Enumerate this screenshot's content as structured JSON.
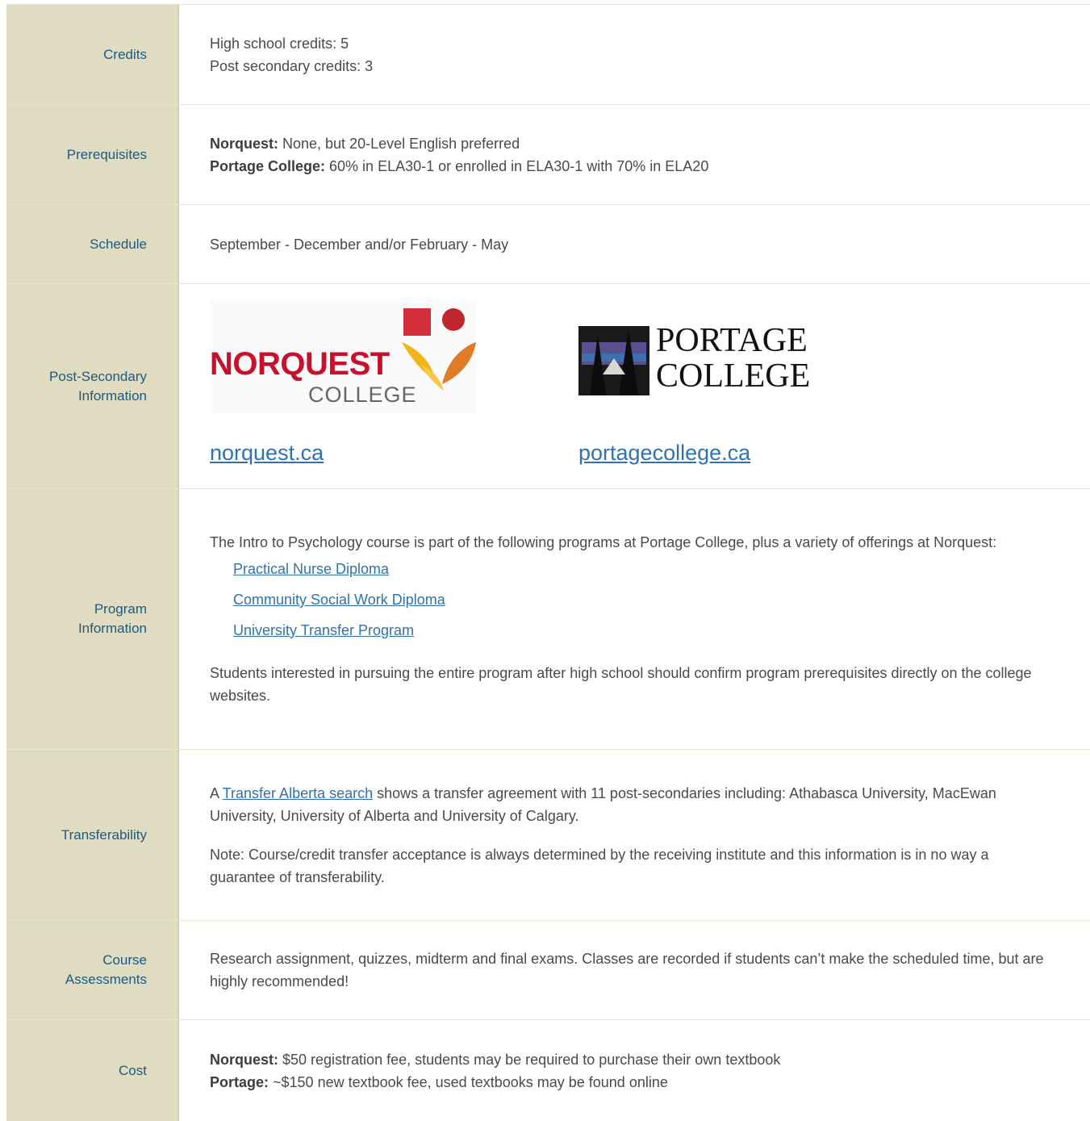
{
  "rows": {
    "credits": {
      "label": "Credits",
      "line1": "High school credits: 5",
      "line2": "Post secondary credits: 3"
    },
    "prerequisites": {
      "label": "Prerequisites",
      "norquest_label": "Norquest:",
      "norquest_text": " None, but 20-Level English preferred",
      "portage_label": "Portage College:",
      "portage_text": " 60% in ELA30-1 or enrolled in ELA30-1 with 70% in ELA20"
    },
    "schedule": {
      "label": "Schedule",
      "text": "September - December and/or February - May"
    },
    "post_secondary": {
      "label": "Post-Secondary\nInformation",
      "norquest_logo_word": "NORQUEST",
      "norquest_logo_sub": "COLLEGE",
      "portage_logo_line1": "PORTAGE",
      "portage_logo_line2": "COLLEGE",
      "norquest_link": "norquest.ca",
      "portage_link": "portagecollege.ca"
    },
    "program": {
      "label": "Program\nInformation",
      "intro": "The Intro to Psychology course is part of the following programs at Portage College, plus a variety of offerings at Norquest:",
      "links": [
        "Practical Nurse Diploma",
        "Community Social Work Diploma",
        "University Transfer Program"
      ],
      "note": "Students interested in pursuing the entire program after high school should confirm program prerequisites directly on the college websites."
    },
    "transferability": {
      "label": "Transferability",
      "prefix": "A ",
      "link": "Transfer Alberta search",
      "suffix": " shows a transfer agreement with 11 post-secondaries including: Athabasca University, MacEwan University, University of Alberta and University of Calgary.",
      "note": "Note: Course/credit transfer acceptance is always determined by the receiving institute and this information is in no way a guarantee of transferability."
    },
    "assessments": {
      "label": "Course\nAssessments",
      "text": "Research assignment, quizzes, midterm and final exams. Classes are recorded if students can’t make the scheduled time, but are highly recommended!"
    },
    "cost": {
      "label": "Cost",
      "norquest_label": "Norquest:",
      "norquest_text": " $50 registration fee, students may be required to purchase their own textbook",
      "portage_label": "Portage:",
      "portage_text": " ~$150 new textbook fee, used textbooks may be found online"
    }
  },
  "colors": {
    "label_bg": "#e0dcc1",
    "label_text": "#1b5a84",
    "link": "#2f72b0",
    "norquest_red": "#c8102e"
  }
}
